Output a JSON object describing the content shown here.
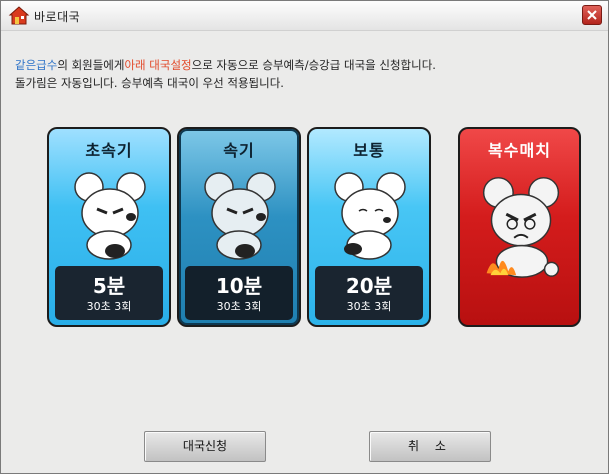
{
  "window": {
    "title": "바로대국",
    "close_label": "X"
  },
  "description": {
    "line1_highlight_blue": "같은급수",
    "line1_part2": "의 회원들에게",
    "line1_highlight_red": "아래 대국설정",
    "line1_part3": "으로 자동으로 승부예측/승강급 대국을 신청합니다.",
    "line2": "돌가림은 자동입니다. 승부예측 대국이 우선 적용됩니다."
  },
  "cards": [
    {
      "title": "초속기",
      "time": "5분",
      "byoyomi": "30초 3회",
      "color": "#3fc0f3"
    },
    {
      "title": "속기",
      "time": "10분",
      "byoyomi": "30초 3회",
      "color": "#2d91c2"
    },
    {
      "title": "보통",
      "time": "20분",
      "byoyomi": "30초 3회",
      "color": "#48c6f5"
    },
    {
      "title": "복수매치",
      "color": "#d41c1c"
    }
  ],
  "buttons": {
    "apply": "대국신청",
    "cancel": "취 소"
  }
}
